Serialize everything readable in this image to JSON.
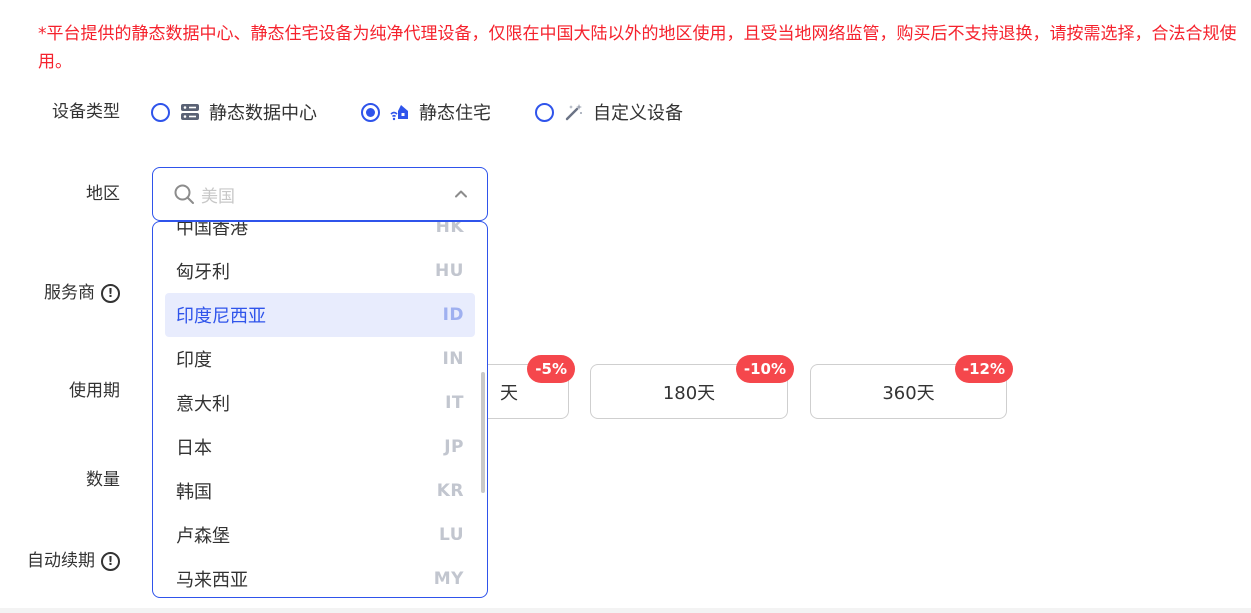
{
  "notice": "*平台提供的静态数据中心、静态住宅设备为纯净代理设备，仅限在中国大陆以外的地区使用，且受当地网络监管，购买后不支持退换，请按需选择，合法合规使用。",
  "labels": {
    "device_type": "设备类型",
    "region": "地区",
    "provider": "服务商",
    "period": "使用期",
    "quantity": "数量",
    "auto_renew": "自动续期"
  },
  "device_types": [
    {
      "label": "静态数据中心",
      "icon": "server-icon",
      "checked": false
    },
    {
      "label": "静态住宅",
      "icon": "residential-icon",
      "checked": true
    },
    {
      "label": "自定义设备",
      "icon": "magic-wand-icon",
      "checked": false
    }
  ],
  "region_select": {
    "placeholder": "美国",
    "icon": "search-icon",
    "expanded": true
  },
  "region_options": [
    {
      "name": "中国香港",
      "code": "HK"
    },
    {
      "name": "匈牙利",
      "code": "HU"
    },
    {
      "name": "印度尼西亚",
      "code": "ID",
      "active": true
    },
    {
      "name": "印度",
      "code": "IN"
    },
    {
      "name": "意大利",
      "code": "IT"
    },
    {
      "name": "日本",
      "code": "JP"
    },
    {
      "name": "韩国",
      "code": "KR"
    },
    {
      "name": "卢森堡",
      "code": "LU"
    },
    {
      "name": "马来西亚",
      "code": "MY"
    }
  ],
  "periods": [
    {
      "label": "天",
      "discount": "-5%"
    },
    {
      "label": "180天",
      "discount": "-10%"
    },
    {
      "label": "360天",
      "discount": "-12%"
    }
  ],
  "colors": {
    "accent": "#2f54eb",
    "notice": "#f5222d",
    "badge": "#f5474c",
    "active_bg": "#e8ecfd"
  }
}
